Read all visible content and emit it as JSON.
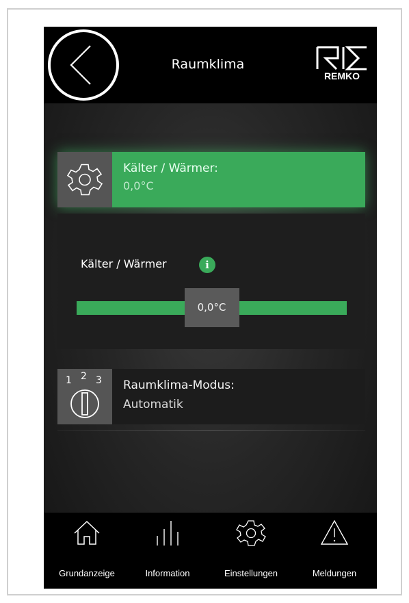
{
  "header": {
    "title": "Raumklima",
    "logo_text": "REMKO",
    "back_icon": "chevron-left-icon"
  },
  "setpoint_card": {
    "label": "Kälter / Wärmer:",
    "value": "0,0°C",
    "icon": "gear-icon",
    "accent_color": "#3aaa5a"
  },
  "slider": {
    "label": "Kälter / Wärmer",
    "info_icon": "info-icon",
    "info_glyph": "i",
    "handle_value": "0,0°C",
    "position_fraction": 0.5
  },
  "mode_card": {
    "label": "Raumklima-Modus:",
    "value": "Automatik",
    "icon": "mode-selector-icon",
    "icon_digits": [
      "1",
      "2",
      "3"
    ]
  },
  "bottom_nav": {
    "items": [
      {
        "label": "Grundanzeige",
        "icon": "home-icon"
      },
      {
        "label": "Information",
        "icon": "bars-icon"
      },
      {
        "label": "Einstellungen",
        "icon": "gear-icon"
      },
      {
        "label": "Meldungen",
        "icon": "warning-icon"
      }
    ]
  }
}
